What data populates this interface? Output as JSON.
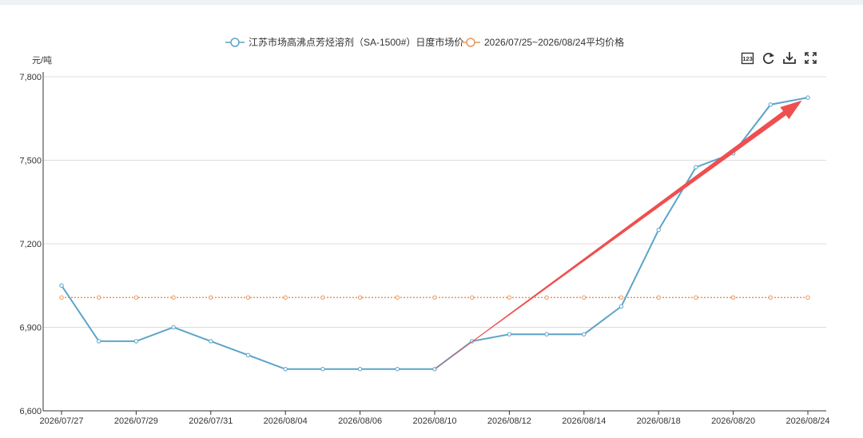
{
  "toolbar": {
    "icons": [
      "data-view-icon",
      "refresh-icon",
      "download-icon",
      "fullscreen-icon"
    ]
  },
  "chart_data": {
    "type": "line",
    "ylabel": "元/吨",
    "ylim": [
      6600,
      7800
    ],
    "yticks": [
      "6,600",
      "6,900",
      "7,200",
      "7,500",
      "7,800"
    ],
    "ytick_values": [
      6600,
      6900,
      7200,
      7500,
      7800
    ],
    "x": [
      "2026/07/27",
      "2026/07/28",
      "2026/07/29",
      "2026/07/30",
      "2026/07/31",
      "2026/08/03",
      "2026/08/04",
      "2026/08/05",
      "2026/08/06",
      "2026/08/07",
      "2026/08/10",
      "2026/08/11",
      "2026/08/12",
      "2026/08/13",
      "2026/08/14",
      "2026/08/17",
      "2026/08/18",
      "2026/08/19",
      "2026/08/20",
      "2026/08/21",
      "2026/08/24"
    ],
    "xtick_labels": [
      "2026/07/27",
      "2026/07/29",
      "2026/07/31",
      "2026/08/04",
      "2026/08/06",
      "2026/08/10",
      "2026/08/12",
      "2026/08/14",
      "2026/08/18",
      "2026/08/20",
      "2026/08/24"
    ],
    "series": [
      {
        "name": "江苏市场高沸点芳烃溶剂（SA-1500#）日度市场价",
        "color": "#5ba4c9",
        "values": [
          7050,
          6850,
          6850,
          6900,
          6850,
          6800,
          6750,
          6750,
          6750,
          6750,
          6750,
          6850,
          6875,
          6875,
          6875,
          6975,
          7250,
          7475,
          7525,
          7700,
          7725
        ]
      },
      {
        "name": "2026/07/25~2026/08/24平均价格",
        "color": "#e8965a",
        "style": "dotted",
        "values": [
          7007,
          7007,
          7007,
          7007,
          7007,
          7007,
          7007,
          7007,
          7007,
          7007,
          7007,
          7007,
          7007,
          7007,
          7007,
          7007,
          7007,
          7007,
          7007,
          7007,
          7007
        ]
      }
    ],
    "annotations": [
      {
        "type": "arrow",
        "color": "#ef4f4f",
        "from": [
          "2026/08/10",
          6750
        ],
        "to": [
          "2026/08/24",
          7725
        ]
      }
    ],
    "legend_position": "top-center",
    "grid": true
  }
}
